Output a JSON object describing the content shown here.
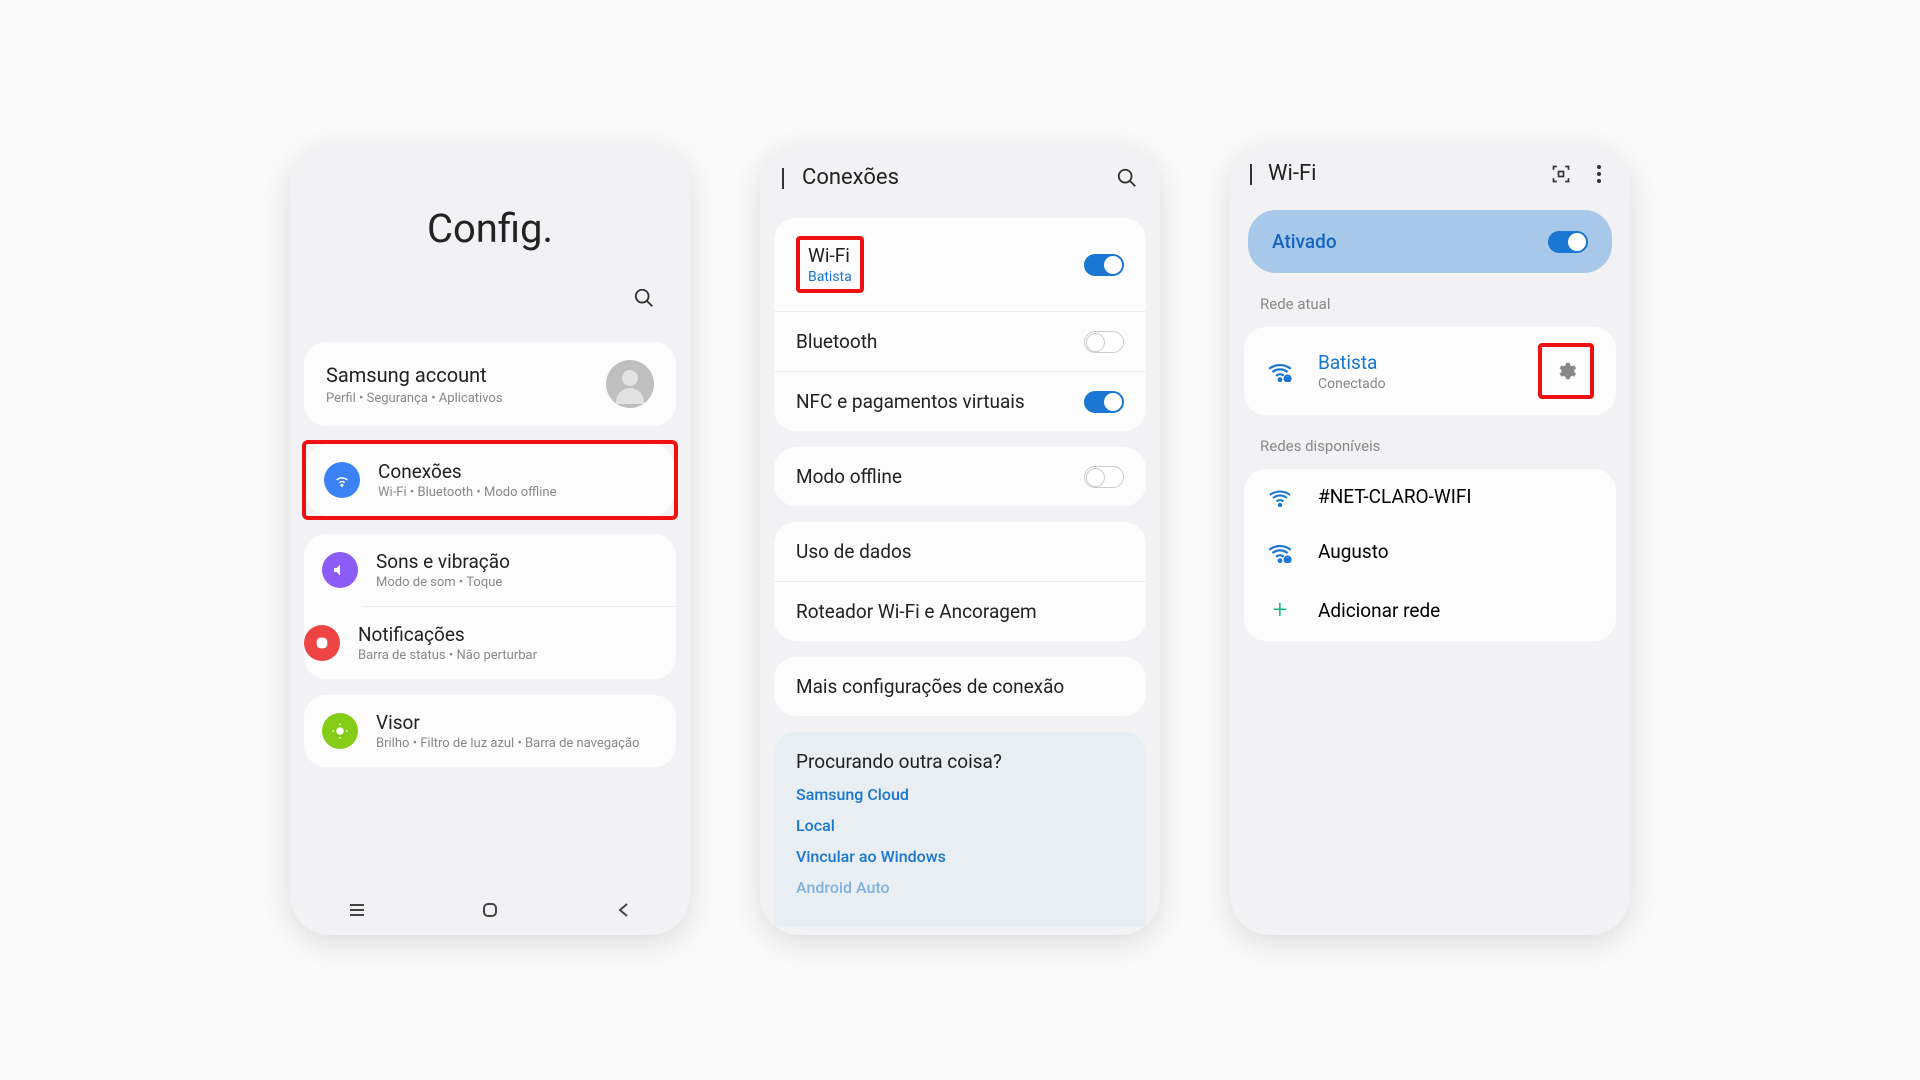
{
  "phone1": {
    "title": "Config.",
    "account": {
      "title": "Samsung account",
      "subtitle": "Perfil  •  Segurança  •  Aplicativos"
    },
    "items": [
      {
        "title": "Conexões",
        "subtitle": "Wi-Fi  •  Bluetooth  •  Modo offline"
      },
      {
        "title": "Sons e vibração",
        "subtitle": "Modo de som  •  Toque"
      },
      {
        "title": "Notificações",
        "subtitle": "Barra de status  •  Não perturbar"
      },
      {
        "title": "Visor",
        "subtitle": "Brilho  •  Filtro de luz azul  •  Barra de navegação"
      }
    ]
  },
  "phone2": {
    "title": "Conexões",
    "wifi": {
      "label": "Wi-Fi",
      "network": "Batista"
    },
    "items": [
      {
        "label": "Bluetooth"
      },
      {
        "label": "NFC e pagamentos virtuais"
      },
      {
        "label": "Modo offline"
      },
      {
        "label": "Uso de dados"
      },
      {
        "label": "Roteador Wi-Fi e Ancoragem"
      },
      {
        "label": "Mais configurações de conexão"
      }
    ],
    "footer": {
      "heading": "Procurando outra coisa?",
      "links": [
        "Samsung Cloud",
        "Local",
        "Vincular ao Windows",
        "Android Auto"
      ]
    }
  },
  "phone3": {
    "title": "Wi-Fi",
    "enabled_label": "Ativado",
    "current_label": "Rede atual",
    "current": {
      "name": "Batista",
      "status": "Conectado"
    },
    "available_label": "Redes disponíveis",
    "networks": [
      "#NET-CLARO-WIFI",
      "Augusto"
    ],
    "add_label": "Adicionar rede"
  }
}
